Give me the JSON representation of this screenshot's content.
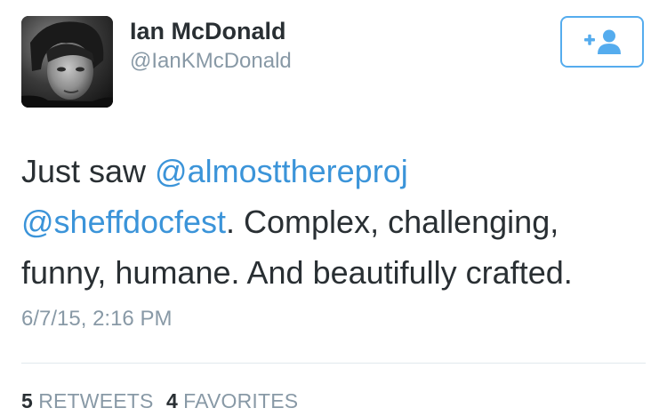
{
  "user": {
    "display_name": "Ian McDonald",
    "handle": "@IanKMcDonald"
  },
  "follow_button": {
    "icon": "add-user-icon",
    "color": "#55acee"
  },
  "tweet": {
    "line1_text": "Just saw ",
    "mention1": "@almostthereproj",
    "mention2": "@sheffdocfest",
    "line2_text": ". Complex, challenging,",
    "line3_text": "funny, humane. And beautifully crafted.",
    "timestamp": "6/7/15, 2:16 PM"
  },
  "stats": {
    "retweets_count": "5",
    "retweets_label": "RETWEETS",
    "favorites_count": "4",
    "favorites_label": "FAVORITES"
  },
  "colors": {
    "link": "#3b94d9",
    "text": "#292f33",
    "muted": "#8899a6",
    "divider": "#e1e8ed"
  }
}
